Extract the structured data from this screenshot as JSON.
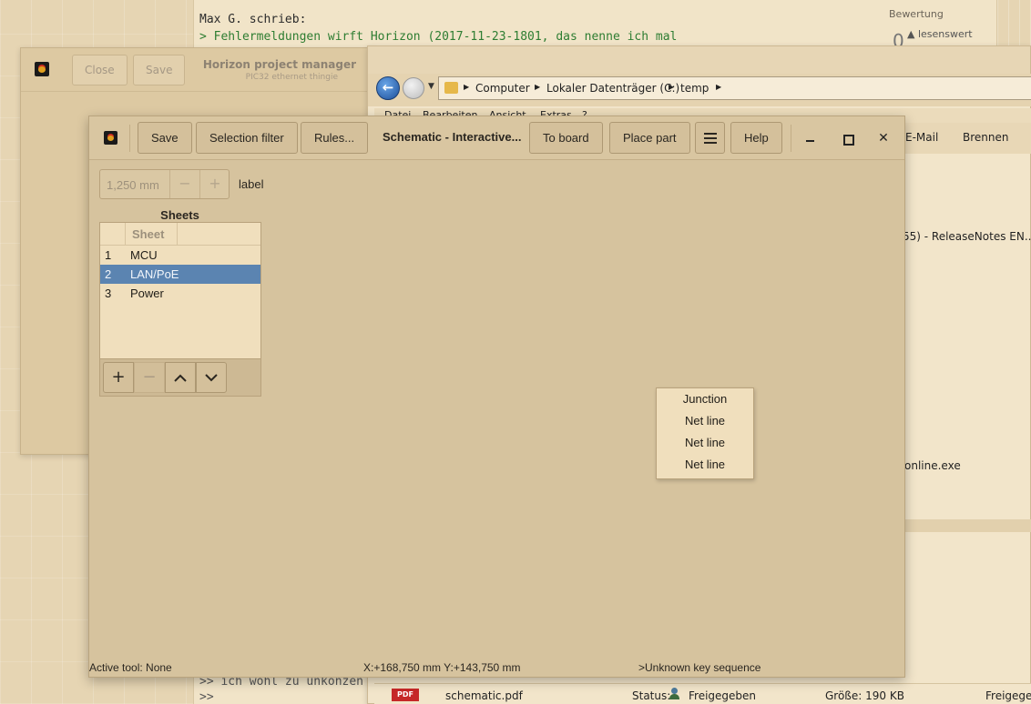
{
  "forum": {
    "author_line": "Max G. schrieb:",
    "quote_line1": "> Fehlermeldungen wirft Horizon (2017-11-23-1801, das nenne ich mal",
    "quote_line2": ">> ich wohl zu unkonzen",
    "quote_line3": ">>",
    "rating_label": "Bewertung",
    "rating_value": "0",
    "rating_link": "lesenswert"
  },
  "project_manager": {
    "close_label": "Close",
    "save_label": "Save",
    "title": "Horizon project manager",
    "subtitle": "PIC32 ethernet thingie"
  },
  "explorer": {
    "back_glyph": "←",
    "breadcrumbs": [
      "Computer",
      "Lokaler Datenträger (C:)",
      "temp"
    ],
    "menus": [
      "Datei",
      "Bearbeiten",
      "Ansicht",
      "Extras",
      "?"
    ],
    "toolbar": [
      "E-Mail",
      "Brennen"
    ],
    "release_notes_text": "55) - ReleaseNotes EN....",
    "exe_text": "online.exe",
    "file": {
      "icon_label": "PDF",
      "name": "schematic.pdf",
      "status_label": "Status:",
      "status_value": "Freigegeben",
      "size_label": "Größe: 190 KB",
      "shared_text": "Freigegeb"
    }
  },
  "schematic": {
    "header": {
      "save": "Save",
      "selection_filter": "Selection filter",
      "rules": "Rules...",
      "title": "Schematic - Interactive...",
      "to_board": "To board",
      "place_part": "Place part",
      "menu_icon": "hamburger-menu-icon",
      "help": "Help",
      "close_glyph": "✕"
    },
    "grid": {
      "value": "1,250 mm",
      "decrement": "−",
      "increment": "+",
      "label": "label"
    },
    "sheets": {
      "title": "Sheets",
      "column_header": "Sheet",
      "rows": [
        {
          "num": "1",
          "name": "MCU"
        },
        {
          "num": "2",
          "name": "LAN/PoE"
        },
        {
          "num": "3",
          "name": "Power"
        }
      ],
      "selected_index": 1,
      "tools": {
        "add": "+",
        "remove": "−",
        "up": "⌃",
        "down": "⌄"
      }
    },
    "context_menu": [
      "Junction",
      "Net line",
      "Net line",
      "Net line"
    ],
    "status": {
      "active_tool": "Active tool: None",
      "coords": "X:+168,750 mm Y:+143,750 mm",
      "key_sequence": ">Unknown key sequence"
    }
  },
  "colors": {
    "selection": "#5b84b1",
    "window_bg": "#d6c39e",
    "quote_green": "#2e7d32"
  }
}
